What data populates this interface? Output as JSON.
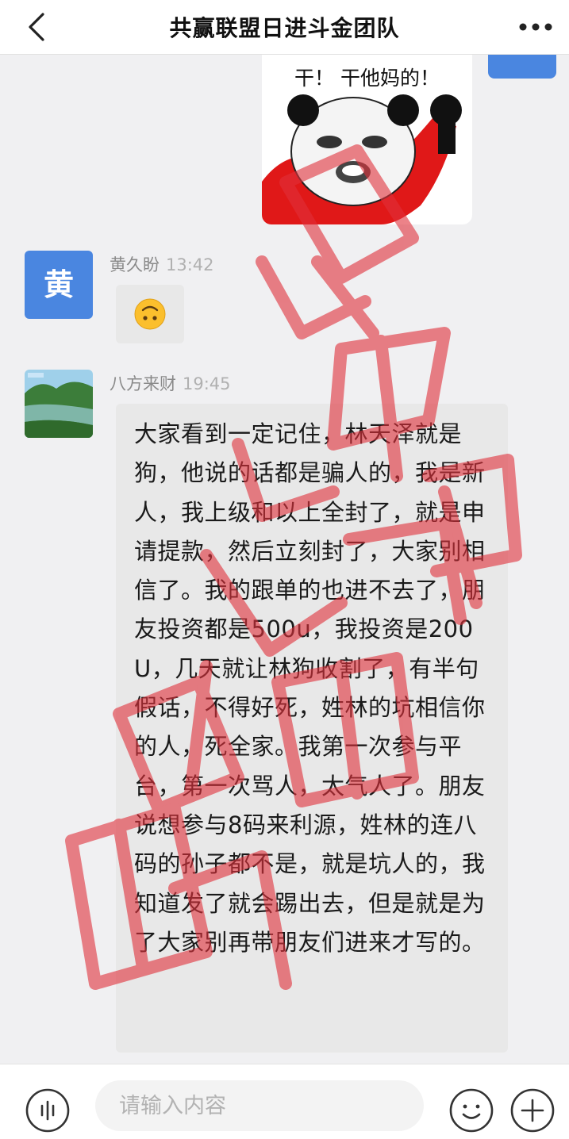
{
  "header": {
    "title": "共赢联盟日进斗金团队",
    "back_icon": "chevron-left-icon",
    "more_icon": "more-horizontal-icon"
  },
  "messages": [
    {
      "type": "sticker",
      "side": "right",
      "sticker_text": "干！ 干他妈的！"
    },
    {
      "type": "emoji",
      "side": "left",
      "sender": "黄久盼",
      "time": "13:42",
      "avatar_text": "黄",
      "emoji": "upside-down-face"
    },
    {
      "type": "text",
      "side": "left",
      "sender": "八方来财",
      "time": "19:45",
      "avatar": "landscape-photo",
      "text": "大家看到一定记住，林天泽就是狗，他说的话都是骗人的，我是新人，我上级和以上全封了，就是申请提款，然后立刻封了，大家别相信了。我的跟单的也进不去了，朋友投资都是500u，我投资是200U，几天就让林狗收割了，有半句假话，不得好死，姓林的坑相信你的人，死全家。我第一次参与平台，第一次骂人，太气人了。朋友说想参与8码来利源，姓林的连八码的孙子都不是，就是坑人的，我知道发了就会踢出去，但是就是为了大家别再带朋友们进来才写的。"
    }
  ],
  "input": {
    "placeholder": "请输入内容",
    "value": ""
  },
  "input_bar_icons": [
    "voice-icon",
    "emoji-icon",
    "plus-icon"
  ],
  "colors": {
    "accent": "#4a86e0",
    "stamp": "#e0303a",
    "background": "#f0f0f2",
    "bubble": "#e8e8e8"
  }
}
